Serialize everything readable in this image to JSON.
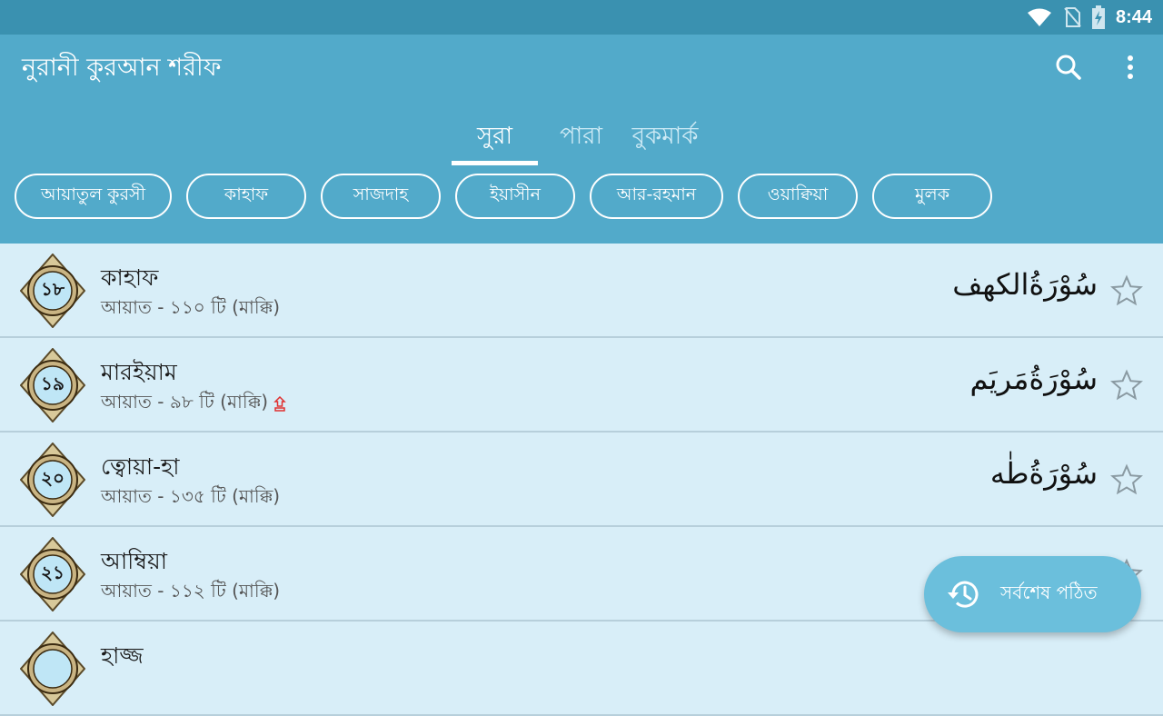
{
  "status_bar": {
    "time": "8:44"
  },
  "app_bar": {
    "title": "নুরানী কুরআন শরীফ",
    "search_icon": "search-icon",
    "more_icon": "more-vert-icon"
  },
  "tabs": [
    {
      "label": "সুরা",
      "active": true
    },
    {
      "label": "পারা",
      "active": false
    },
    {
      "label": "বুকমার্ক",
      "active": false
    }
  ],
  "chips": [
    {
      "label": "আয়াতুল কুরসী"
    },
    {
      "label": "কাহাফ"
    },
    {
      "label": "সাজদাহ"
    },
    {
      "label": "ইয়াসীন"
    },
    {
      "label": "আর-রহমান"
    },
    {
      "label": "ওয়াক্বিয়া"
    },
    {
      "label": "মুলক"
    }
  ],
  "surahs": [
    {
      "number": "১৮",
      "name": "কাহাফ",
      "meta": "আয়াত - ১১০ টি (মাক্কি)",
      "arabic": "سُوْرَةُالكهف",
      "sajdah": false
    },
    {
      "number": "১৯",
      "name": "মারইয়াম",
      "meta": "আয়াত - ৯৮ টি (মাক্কি)",
      "arabic": "سُوْرَةُمَريَم",
      "sajdah": true
    },
    {
      "number": "২০",
      "name": "ত্বোয়া-হা",
      "meta": "আয়াত - ১৩৫ টি (মাক্কি)",
      "arabic": "سُوْرَةُطٰه",
      "sajdah": false
    },
    {
      "number": "২১",
      "name": "আম্বিয়া",
      "meta": "আয়াত - ১১২ টি (মাক্কি)",
      "arabic": "",
      "sajdah": false
    },
    {
      "number": "",
      "name": "হাজ্জ",
      "meta": "",
      "arabic": "",
      "sajdah": false
    }
  ],
  "fab": {
    "label": "সর্বশেষ পঠিত",
    "icon": "history-icon"
  },
  "colors": {
    "primary": "#52aaca",
    "status": "#3a91b0",
    "list_bg": "#d8eef8",
    "fab": "#6bbfdc",
    "sajdah": "#e03030"
  }
}
